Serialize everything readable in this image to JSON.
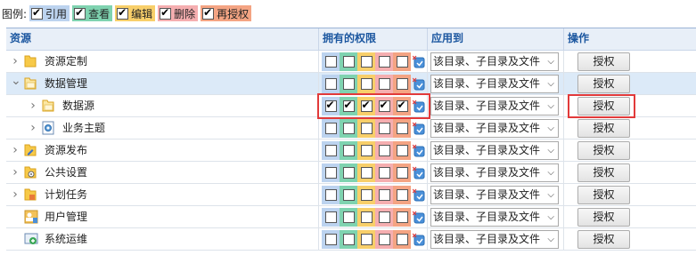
{
  "legend": {
    "label": "图例:",
    "items": [
      {
        "label": "引用",
        "color": "#bcd3ef"
      },
      {
        "label": "查看",
        "color": "#7fd3b0"
      },
      {
        "label": "编辑",
        "color": "#f8cf6a"
      },
      {
        "label": "删除",
        "color": "#f5aeb0"
      },
      {
        "label": "再授权",
        "color": "#f4a483"
      }
    ]
  },
  "table": {
    "headers": {
      "resource": "资源",
      "permissions": "拥有的权限",
      "apply_to": "应用到",
      "operation": "操作"
    },
    "rows": [
      {
        "label": "资源定制",
        "level": 0,
        "expand": "right",
        "icon": "folder-icon",
        "perms": [
          false,
          false,
          false,
          false,
          false
        ],
        "apply": "该目录、子目录及文件",
        "action": "授权",
        "state": "normal"
      },
      {
        "label": "数据管理",
        "level": 0,
        "expand": "down",
        "icon": "folder-open-icon",
        "perms": [
          false,
          false,
          false,
          false,
          false
        ],
        "apply": "该目录、子目录及文件",
        "action": "授权",
        "state": "selected"
      },
      {
        "label": "数据源",
        "level": 1,
        "expand": "right",
        "icon": "folder-open-icon",
        "perms": [
          true,
          true,
          true,
          true,
          true
        ],
        "apply": "该目录、子目录及文件",
        "action": "授权",
        "state": "normal"
      },
      {
        "label": "业务主题",
        "level": 1,
        "expand": "right",
        "icon": "theme-icon",
        "perms": [
          false,
          false,
          false,
          false,
          false
        ],
        "apply": "该目录、子目录及文件",
        "action": "授权",
        "state": "normal"
      },
      {
        "label": "资源发布",
        "level": 0,
        "expand": "right",
        "icon": "publish-icon",
        "perms": [
          false,
          false,
          false,
          false,
          false
        ],
        "apply": "该目录、子目录及文件",
        "action": "授权",
        "state": "normal"
      },
      {
        "label": "公共设置",
        "level": 0,
        "expand": "right",
        "icon": "settings-icon",
        "perms": [
          false,
          false,
          false,
          false,
          false
        ],
        "apply": "该目录、子目录及文件",
        "action": "授权",
        "state": "normal"
      },
      {
        "label": "计划任务",
        "level": 0,
        "expand": "right",
        "icon": "schedule-icon",
        "perms": [
          false,
          false,
          false,
          false,
          false
        ],
        "apply": "该目录、子目录及文件",
        "action": "授权",
        "state": "normal"
      },
      {
        "label": "用户管理",
        "level": 0,
        "expand": "none",
        "icon": "user-manage-icon",
        "perms": [
          false,
          false,
          false,
          false,
          false
        ],
        "apply": "该目录、子目录及文件",
        "action": "授权",
        "state": "normal"
      },
      {
        "label": "系统运维",
        "level": 0,
        "expand": "none",
        "icon": "system-ops-icon",
        "perms": [
          false,
          false,
          false,
          false,
          false
        ],
        "apply": "该目录、子目录及文件",
        "action": "授权",
        "state": "normal"
      }
    ]
  },
  "colors": {
    "highlight_border": "#e23a3a",
    "selected_row": "#dceaf8",
    "header_text": "#1c57a0"
  }
}
